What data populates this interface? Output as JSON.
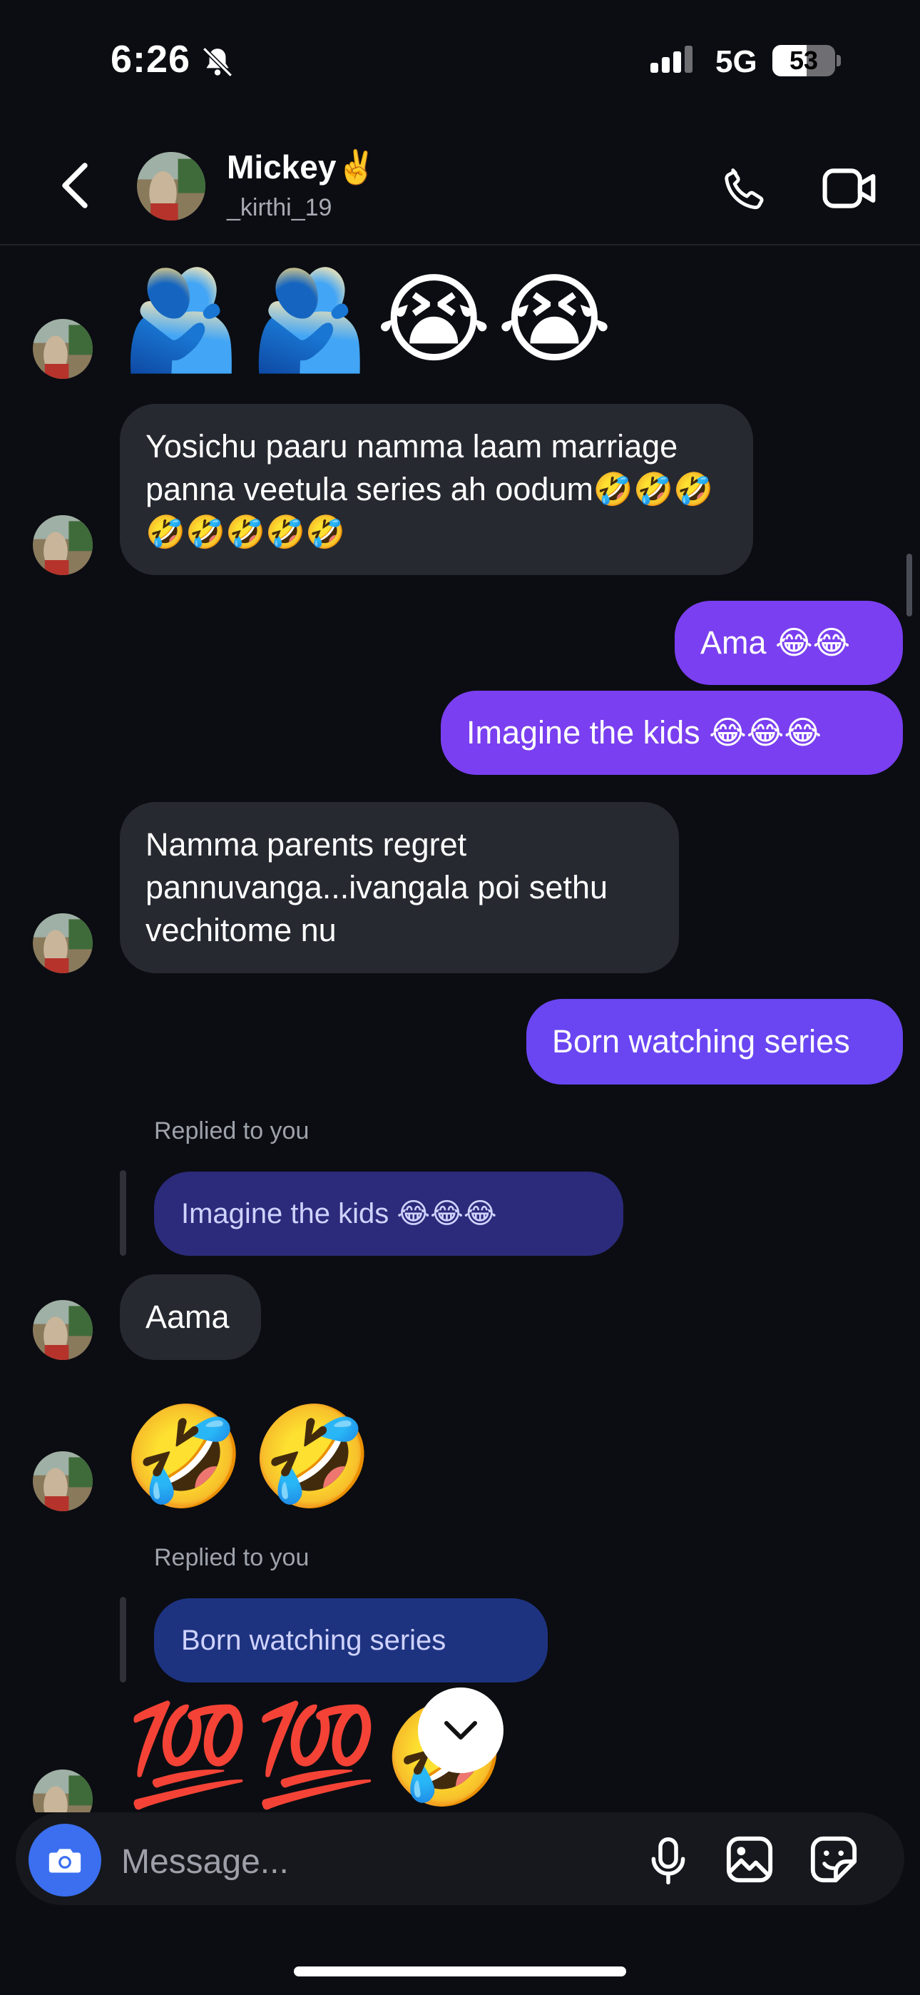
{
  "status_bar": {
    "time": "6:26",
    "network": "5G",
    "battery": "53",
    "battery_level_percent": 53
  },
  "header": {
    "name": "Mickey✌️",
    "username": "_kirthi_19"
  },
  "messages": {
    "m1_emojis": "🫂🫂😭😭",
    "m2_text": "Yosichu paaru namma laam marriage panna veetula series ah oodum🤣🤣🤣🤣🤣🤣🤣🤣",
    "m3_text": "Ama 😂😂",
    "m4_text": "Imagine the kids 😂😂😂",
    "m5_text": "Namma parents regret pannuvanga...ivangala poi sethu vechitome nu",
    "m6_text": "Born watching series",
    "reply1_label": "Replied to you",
    "reply1_quote": "Imagine the kids 😂😂😂",
    "m7_text": "Aama",
    "m8_emojis": "🤣🤣",
    "reply2_label": "Replied to you",
    "reply2_quote": "Born watching series",
    "m9_emojis": "💯💯🤣"
  },
  "composer": {
    "placeholder": "Message..."
  },
  "colors": {
    "background": "#0b0d12",
    "incoming_bubble": "#262930",
    "outgoing_bubble": "#7a3ff0",
    "camera_button": "#3b6ff0"
  },
  "icons": [
    "back-icon",
    "phone-icon",
    "video-icon",
    "camera-icon",
    "microphone-icon",
    "gallery-icon",
    "sticker-icon",
    "chevron-down-icon",
    "bell-muted-icon"
  ]
}
